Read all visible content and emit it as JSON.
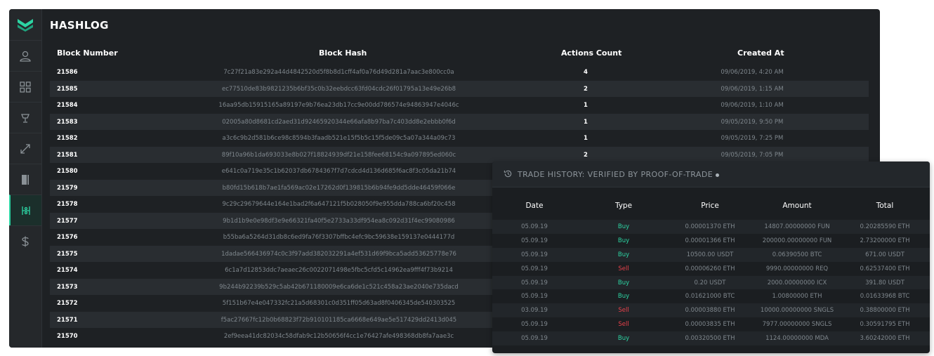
{
  "app": {
    "title": "HASHLOG",
    "brand_color": "#2dd4a3"
  },
  "sidebar": {
    "items": [
      {
        "icon": "user-icon"
      },
      {
        "icon": "dashboard-icon"
      },
      {
        "icon": "trophy-icon"
      },
      {
        "icon": "transfer-icon"
      },
      {
        "icon": "book-icon"
      },
      {
        "icon": "blocks-icon",
        "active": true
      },
      {
        "icon": "dollar-icon"
      }
    ]
  },
  "table": {
    "headers": {
      "block_number": "Block Number",
      "block_hash": "Block Hash",
      "actions_count": "Actions Count",
      "created_at": "Created At"
    },
    "rows": [
      {
        "block": "21586",
        "hash": "7c27f21a83e292a44d4842520d5f8b8d1cff4af0a76d49d281a7aac3e800cc0a",
        "count": "4",
        "created": "09/06/2019, 4:20 AM"
      },
      {
        "block": "21585",
        "hash": "ec77510de83b9821235b6bf35c0b32eebdcc63fd04cdc26f01795a13e49e26b8",
        "count": "2",
        "created": "09/06/2019, 1:15 AM"
      },
      {
        "block": "21584",
        "hash": "16aa95db15915165a89197e9b76ea23db17cc9e00dd786574e94863947e4046c",
        "count": "1",
        "created": "09/06/2019, 1:10 AM"
      },
      {
        "block": "21583",
        "hash": "02005a80d8681cd2aed31d92465920344e66afa8b97ba7c403dd8e2ebbb0f6d",
        "count": "1",
        "created": "09/05/2019, 9:50 PM"
      },
      {
        "block": "21582",
        "hash": "a3c6c9b2d581b6ce98c8594b3faadb521e15f5b5c15f5de09c5a07a344a09c73",
        "count": "1",
        "created": "09/05/2019, 7:25 PM"
      },
      {
        "block": "21581",
        "hash": "89f10a96b1da693033e8b027f18824939df21e158fee68154c9a097895ed060c",
        "count": "2",
        "created": "09/05/2019, 7:05 PM"
      },
      {
        "block": "21580",
        "hash": "e641c0a719e35c1b62037db6784367f7d7cdcd4d136d685f6ac8f3c05da21b74",
        "count": "",
        "created": ""
      },
      {
        "block": "21579",
        "hash": "b80fd15b618b7ae1fa569ac02e17262d0f139815b6b94fe9dd5dde46459f066e",
        "count": "",
        "created": ""
      },
      {
        "block": "21578",
        "hash": "9c29c29679644e164e1bad2f6a647121f5b028050f9e955dda788ca6bf20c458",
        "count": "",
        "created": ""
      },
      {
        "block": "21577",
        "hash": "9b1d1b9e0e98df3e9e66321fa40f5e2733a33df954ea8c092d31f4ec99080986",
        "count": "",
        "created": ""
      },
      {
        "block": "21576",
        "hash": "b55ba6a5264d31db8c6ed9fa76f3307bffbc4efc9bc59638e159137e0444177d",
        "count": "",
        "created": ""
      },
      {
        "block": "21575",
        "hash": "1dadae566436974c0c3f97add382032291a4ef531d69f9bca5add53625778e76",
        "count": "",
        "created": ""
      },
      {
        "block": "21574",
        "hash": "6c1a7d12853ddc7aeaec26c0022071498e5fbc5cfd5c14962ea9fff4f73b9214",
        "count": "",
        "created": ""
      },
      {
        "block": "21573",
        "hash": "9b244b92239b529c5ab42b671180009e6ca6de1c521c458a23ae2040e735dacd",
        "count": "",
        "created": ""
      },
      {
        "block": "21572",
        "hash": "5f151b67e4e047332fc21a5d68301c0d351ff05d63ad8f0406345de540303525",
        "count": "",
        "created": ""
      },
      {
        "block": "21571",
        "hash": "f5ac27667fc12b0b68823f72b910101185ca6668e649ae5e517429dd2413d045",
        "count": "",
        "created": ""
      },
      {
        "block": "21570",
        "hash": "2ef9eea41dc82034c58dfab9c12b50656f4cc1e76427afe498368db8fa7aae3c",
        "count": "",
        "created": ""
      }
    ]
  },
  "trade_history": {
    "title": "TRADE HISTORY: VERIFIED BY PROOF-OF-TRADE",
    "headers": {
      "date": "Date",
      "type": "Type",
      "price": "Price",
      "amount": "Amount",
      "total": "Total"
    },
    "rows": [
      {
        "date": "05.09.19",
        "type": "Buy",
        "price": "0.00001370 ETH",
        "amount": "14807.00000000 FUN",
        "total": "0.20285590 ETH"
      },
      {
        "date": "05.09.19",
        "type": "Buy",
        "price": "0.00001366 ETH",
        "amount": "200000.00000000 FUN",
        "total": "2.73200000 ETH"
      },
      {
        "date": "05.09.19",
        "type": "Buy",
        "price": "10500.00 USDT",
        "amount": "0.06390500 BTC",
        "total": "671.00 USDT"
      },
      {
        "date": "05.09.19",
        "type": "Sell",
        "price": "0.00006260 ETH",
        "amount": "9990.00000000 REQ",
        "total": "0.62537400 ETH"
      },
      {
        "date": "05.09.19",
        "type": "Buy",
        "price": "0.20 USDT",
        "amount": "2000.00000000 ICX",
        "total": "391.80 USDT"
      },
      {
        "date": "05.09.19",
        "type": "Buy",
        "price": "0.01621000 BTC",
        "amount": "1.00800000 ETH",
        "total": "0.01633968 BTC"
      },
      {
        "date": "03.09.19",
        "type": "Sell",
        "price": "0.00003880 ETH",
        "amount": "10000.00000000 SNGLS",
        "total": "0.38800000 ETH"
      },
      {
        "date": "05.09.19",
        "type": "Sell",
        "price": "0.00003835 ETH",
        "amount": "7977.00000000 SNGLS",
        "total": "0.30591795 ETH"
      },
      {
        "date": "05.09.19",
        "type": "Buy",
        "price": "0.00320500 ETH",
        "amount": "1124.00000000 MDA",
        "total": "3.60242000 ETH"
      }
    ]
  }
}
